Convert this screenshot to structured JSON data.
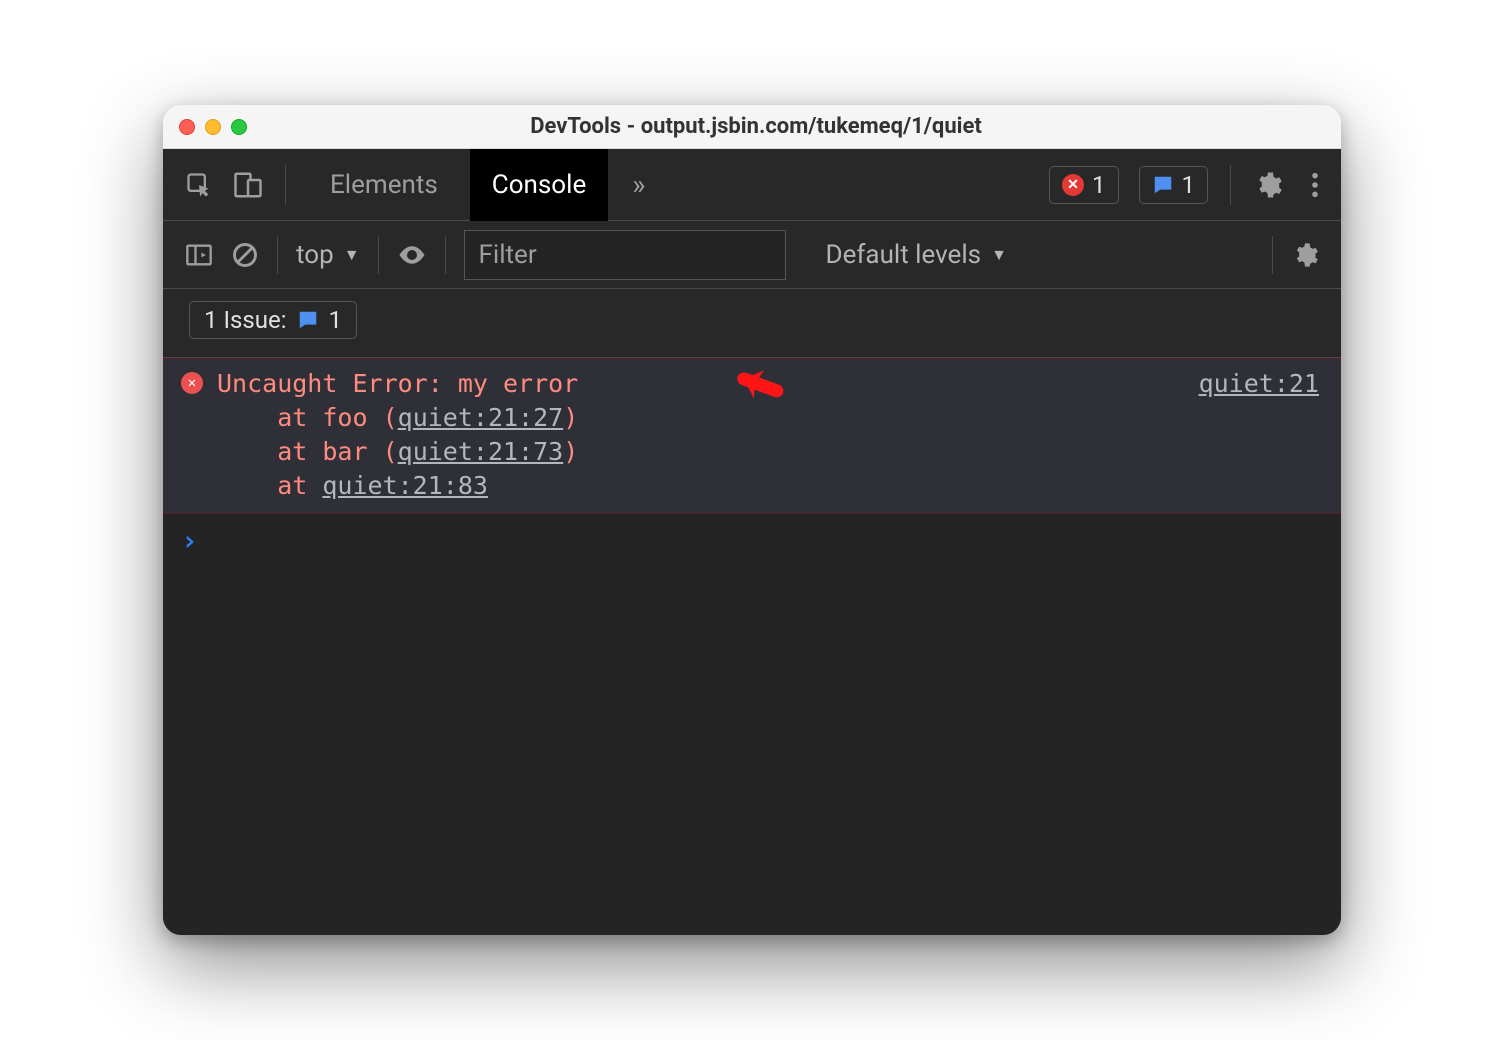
{
  "window": {
    "title": "DevTools - output.jsbin.com/tukemeq/1/quiet"
  },
  "tabs": {
    "elements": "Elements",
    "console": "Console"
  },
  "badges": {
    "errors": "1",
    "messages": "1"
  },
  "toolbar": {
    "context": "top",
    "filterPlaceholder": "Filter",
    "levels": "Default levels"
  },
  "issue": {
    "label": "1 Issue:",
    "count": "1"
  },
  "error": {
    "message": "Uncaught Error: my error",
    "source": "quiet:21",
    "frames": [
      {
        "fn": "foo",
        "loc": "quiet:21:27"
      },
      {
        "fn": "bar",
        "loc": "quiet:21:73"
      },
      {
        "fn": "",
        "loc": "quiet:21:83"
      }
    ]
  }
}
